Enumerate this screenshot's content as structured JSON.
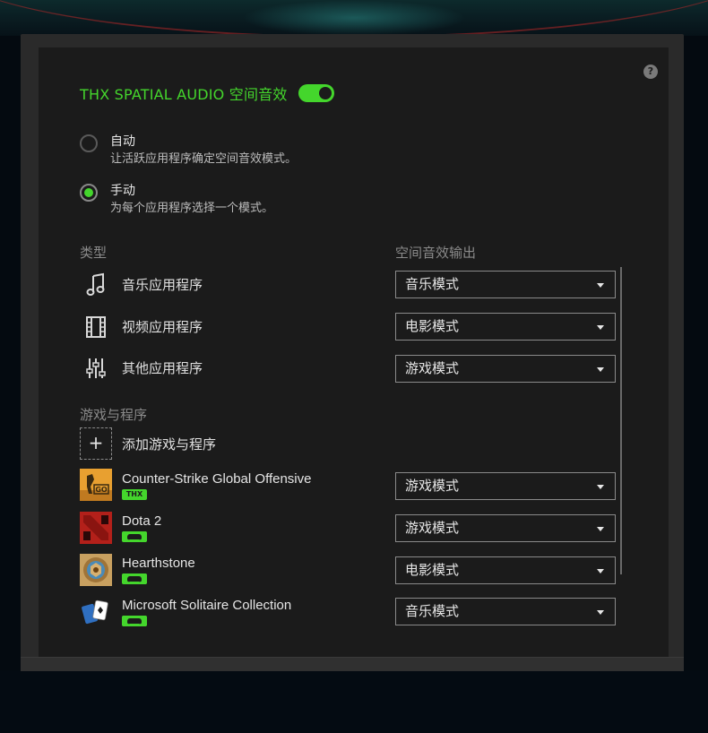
{
  "help": {
    "glyph": "?"
  },
  "header": {
    "title": "THX SPATIAL AUDIO 空间音效",
    "toggle_on": true,
    "accent_color": "#44d62c"
  },
  "mode": {
    "auto": {
      "title": "自动",
      "description": "让活跃应用程序确定空间音效模式。",
      "selected": false
    },
    "manual": {
      "title": "手动",
      "description": "为每个应用程序选择一个模式。",
      "selected": true
    }
  },
  "columns": {
    "type": "类型",
    "output": "空间音效输出"
  },
  "app_types": [
    {
      "label": "音乐应用程序",
      "icon": "music-note-icon",
      "mode": "音乐模式"
    },
    {
      "label": "视频应用程序",
      "icon": "film-strip-icon",
      "mode": "电影模式"
    },
    {
      "label": "其他应用程序",
      "icon": "equalizer-sliders-icon",
      "mode": "游戏模式"
    }
  ],
  "games_section": {
    "title": "游戏与程序",
    "add_label": "添加游戏与程序",
    "add_glyph": "+"
  },
  "games": [
    {
      "name": "Counter-Strike Global Offensive",
      "icon": "csgo-logo-icon",
      "badge": "THX",
      "mode": "游戏模式"
    },
    {
      "name": "Dota 2",
      "icon": "dota2-logo-icon",
      "badge": "gamepad-icon",
      "mode": "游戏模式"
    },
    {
      "name": "Hearthstone",
      "icon": "hearthstone-logo-icon",
      "badge": "gamepad-icon",
      "mode": "电影模式"
    },
    {
      "name": "Microsoft Solitaire Collection",
      "icon": "solitaire-cards-icon",
      "badge": "gamepad-icon",
      "mode": "音乐模式"
    }
  ]
}
